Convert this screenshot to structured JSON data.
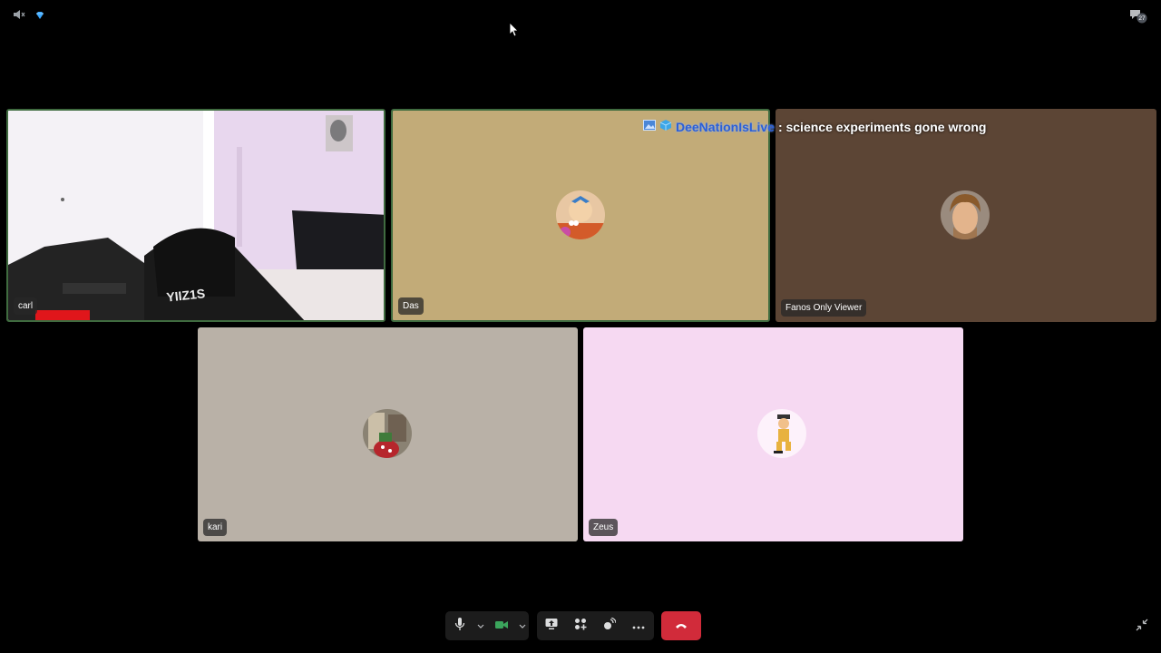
{
  "top": {
    "volume_icon": "speaker-muted-icon",
    "gem_icon": "diamond-icon",
    "chat_icon": "chat-bubbles-icon",
    "chat_badge": "27"
  },
  "banner": {
    "channel": "DeeNationIsLive",
    "message": ": science experiments gone wrong"
  },
  "participants": [
    {
      "name": "carl",
      "type": "video",
      "speaking": true
    },
    {
      "name": "Das",
      "type": "avatar",
      "bg": "#c2ab78",
      "speaking": true
    },
    {
      "name": "Fanos Only Viewer",
      "type": "avatar",
      "bg": "#5c4535",
      "speaking": false
    },
    {
      "name": "kari",
      "type": "avatar",
      "bg": "#b9b1a7",
      "speaking": false
    },
    {
      "name": "Zeus",
      "type": "avatar",
      "bg": "#f6d9f2",
      "speaking": false
    }
  ],
  "toolbar": {
    "mic_icon": "microphone-icon",
    "camera_icon": "video-camera-icon",
    "screenshare_icon": "screen-share-icon",
    "activities_icon": "activities-icon",
    "soundboard_icon": "soundboard-icon",
    "more_icon": "more-icon",
    "hangup_icon": "hang-up-icon",
    "camera_color": "#3ba55c",
    "hangup_color": "#d12b3a"
  }
}
